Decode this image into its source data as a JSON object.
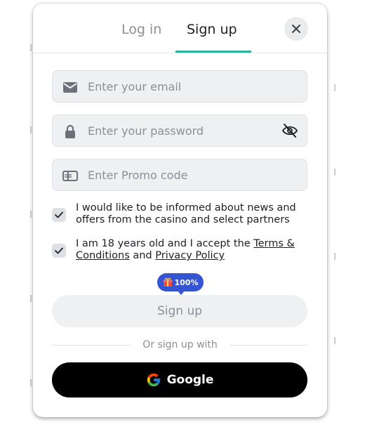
{
  "tabs": {
    "login": "Log in",
    "signup": "Sign up"
  },
  "fields": {
    "email": {
      "placeholder": "Enter your email",
      "value": ""
    },
    "password": {
      "placeholder": "Enter your password",
      "value": ""
    },
    "promo": {
      "placeholder": "Enter Promo code",
      "value": ""
    }
  },
  "checkboxes": {
    "news": {
      "text": "I would like to be informed about news and offers from the casino and select partners",
      "checked": true
    },
    "terms": {
      "prefix": "I am 18 years old and I accept the ",
      "terms_link": "Terms & Conditions",
      "middle": " and ",
      "privacy_link": "Privacy Policy",
      "checked": true
    }
  },
  "badge": {
    "text": "100%",
    "icon": "gift-icon"
  },
  "signup_button": "Sign up",
  "divider_text": "Or sign up with",
  "google_button": "Google",
  "colors": {
    "accent": "#2bb39a",
    "badge": "#3554d1",
    "google_bg": "#000000"
  }
}
